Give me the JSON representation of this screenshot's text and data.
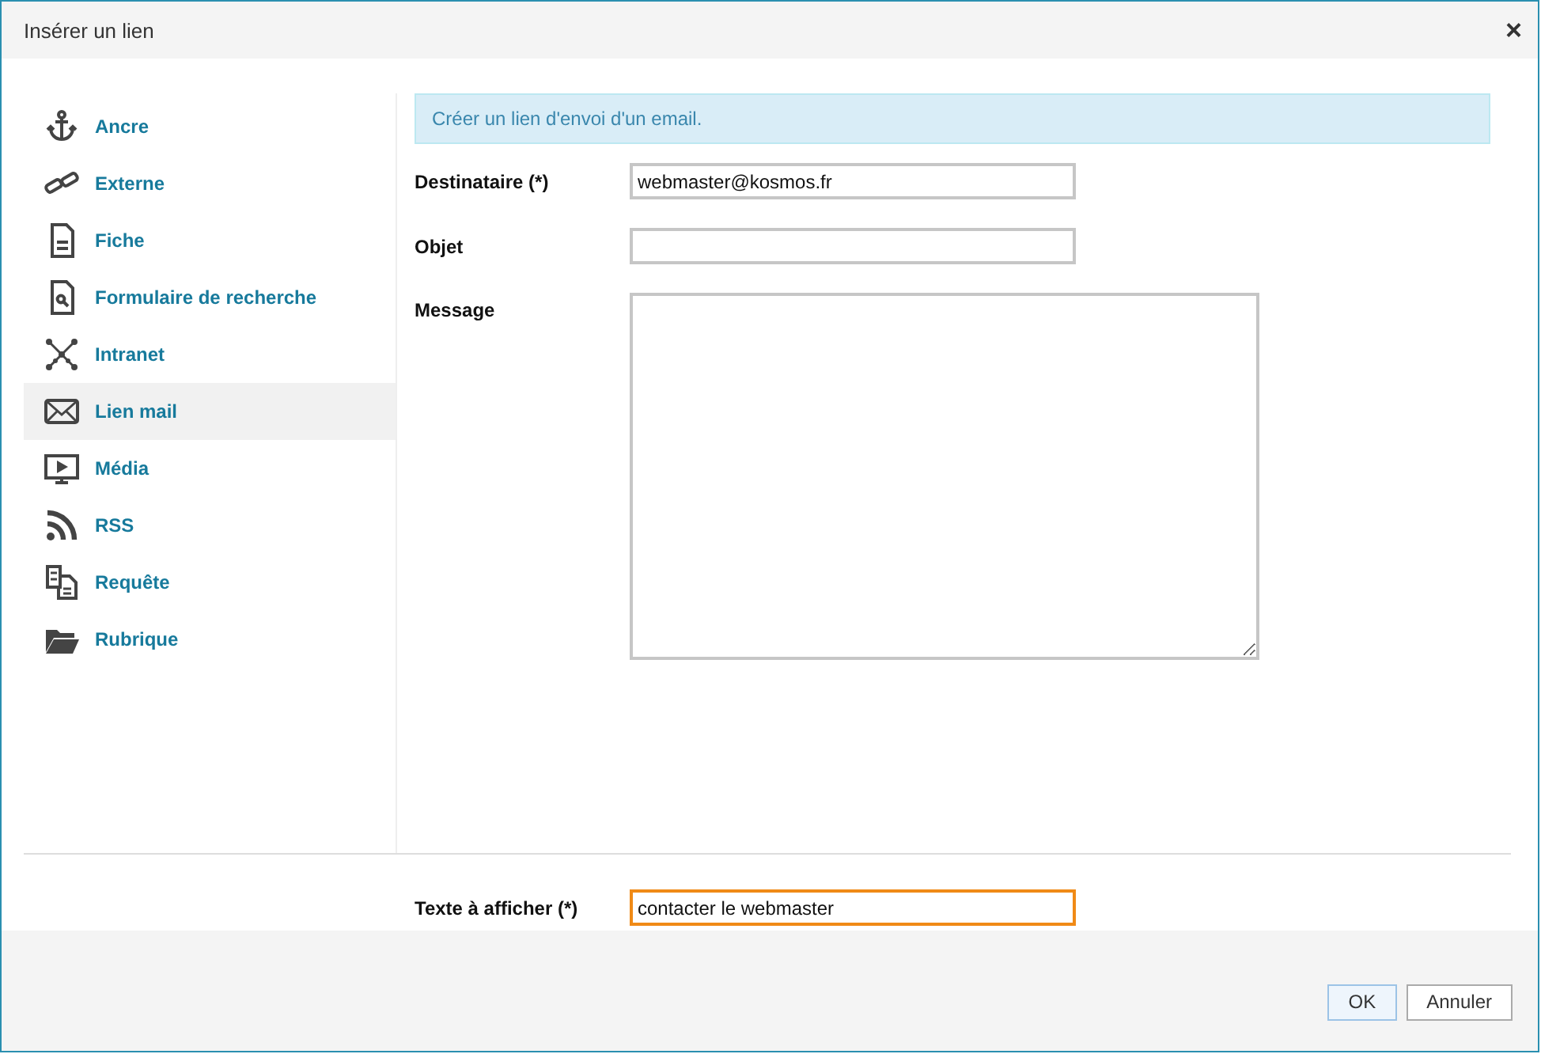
{
  "window": {
    "title": "Insérer un lien",
    "close": "×"
  },
  "sidebar": {
    "items": [
      {
        "label": "Ancre",
        "selected": false
      },
      {
        "label": "Externe",
        "selected": false
      },
      {
        "label": "Fiche",
        "selected": false
      },
      {
        "label": "Formulaire de recherche",
        "selected": false
      },
      {
        "label": "Intranet",
        "selected": false
      },
      {
        "label": "Lien mail",
        "selected": true
      },
      {
        "label": "Média",
        "selected": false
      },
      {
        "label": "RSS",
        "selected": false
      },
      {
        "label": "Requête",
        "selected": false
      },
      {
        "label": "Rubrique",
        "selected": false
      }
    ]
  },
  "info": "Créer un lien d'envoi d'un email.",
  "fields": [
    {
      "kind": "text",
      "label": "Destinataire (*)",
      "value": "webmaster@kosmos.fr"
    },
    {
      "kind": "text",
      "label": "Objet"
    },
    {
      "kind": "textarea",
      "label": "Message"
    }
  ],
  "display_text": {
    "label": "Texte à afficher (*)",
    "value": "contacter le webmaster",
    "focused": true
  },
  "buttons": [
    {
      "label": "OK",
      "default": true
    },
    {
      "label": "Annuler",
      "default": false
    }
  ]
}
